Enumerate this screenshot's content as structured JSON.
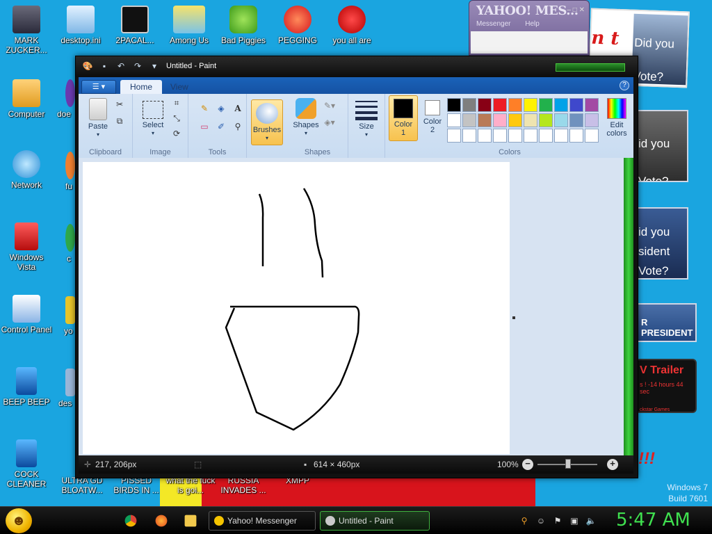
{
  "desktop": {
    "icons_left": [
      {
        "label": "MARK ZUCKER...",
        "icon": "person-icon"
      },
      {
        "label": "Computer",
        "icon": "computer-icon"
      },
      {
        "label": "Network",
        "icon": "network-icon"
      },
      {
        "label": "Windows Vista",
        "icon": "recycle-bin-icon"
      },
      {
        "label": "Control Panel",
        "icon": "control-panel-icon"
      },
      {
        "label": "BEEP BEEP",
        "icon": "file-icon"
      },
      {
        "label": "COCK CLEANER",
        "icon": "file-icon"
      }
    ],
    "icons_top": [
      {
        "label": "desktop.ini",
        "icon": "settings-file-icon"
      },
      {
        "label": "2PACAL...",
        "icon": "cmd-icon"
      },
      {
        "label": "Among Us",
        "icon": "among-us-icon"
      },
      {
        "label": "Bad Piggies",
        "icon": "bad-piggies-icon"
      },
      {
        "label": "PEGGING",
        "icon": "pegging-icon"
      },
      {
        "label": "you all are",
        "icon": "dev-cpp-icon"
      }
    ],
    "col2_partial": [
      "doe",
      "fu",
      "c",
      "yo",
      "des"
    ],
    "bottom_row": [
      "ULTRA GD BLOATW...",
      "PISSED BIRDS IN ...",
      "what the fuck is goi...",
      "RUSSIA INVADES ...",
      "XMPP"
    ],
    "ads": {
      "ad1_text": "Did you Vote?",
      "ad1_partial": "n t",
      "ad2_text": "id you Vote?",
      "ad3_text": "id you sident Vote?",
      "ad4_text": "R PRESIDENT",
      "ad5_title": "V Trailer",
      "ad5_sub": "s ! -14 hours 44 sec",
      "ad5_brand": "ckstar Games",
      "exclaim": "!!!"
    },
    "os_label": "Windows 7",
    "build_label": "Build 7601"
  },
  "yahoo_window": {
    "title": "YAHOO! MES...",
    "menu": [
      "Messenger",
      "Help"
    ]
  },
  "paint": {
    "window_title": "Untitled - Paint",
    "tabs": [
      "Home",
      "View"
    ],
    "active_tab": "Home",
    "groups": {
      "clipboard": "Clipboard",
      "image": "Image",
      "tools": "Tools",
      "shapes": "Shapes",
      "colors": "Colors"
    },
    "buttons": {
      "paste": "Paste",
      "select": "Select",
      "brushes": "Brushes",
      "shapes": "Shapes",
      "size": "Size",
      "color1": "Color 1",
      "color2": "Color 2",
      "edit_colors": "Edit colors"
    },
    "palette": [
      "#000000",
      "#7f7f7f",
      "#880015",
      "#ed1c24",
      "#ff7f27",
      "#fff200",
      "#22b14c",
      "#00a2e8",
      "#3f48cc",
      "#a349a4",
      "#ffffff",
      "#c3c3c3",
      "#b97a57",
      "#ffaec9",
      "#ffc90e",
      "#efe4b0",
      "#b5e61d",
      "#99d9ea",
      "#7092be",
      "#c8bfe7",
      "#ffffff",
      "#ffffff",
      "#ffffff",
      "#ffffff",
      "#ffffff",
      "#ffffff",
      "#ffffff",
      "#ffffff",
      "#ffffff",
      "#ffffff"
    ],
    "color1_value": "#000000",
    "color2_value": "#ffffff",
    "status": {
      "cursor_pos": "217, 206px",
      "canvas_size": "614 × 460px",
      "zoom": "100%"
    }
  },
  "taskbar": {
    "tasks": [
      {
        "label": "Yahoo! Messenger",
        "icon": "yahoo-icon"
      },
      {
        "label": "Untitled - Paint",
        "icon": "paint-icon"
      }
    ],
    "clock": "5:47 AM"
  }
}
